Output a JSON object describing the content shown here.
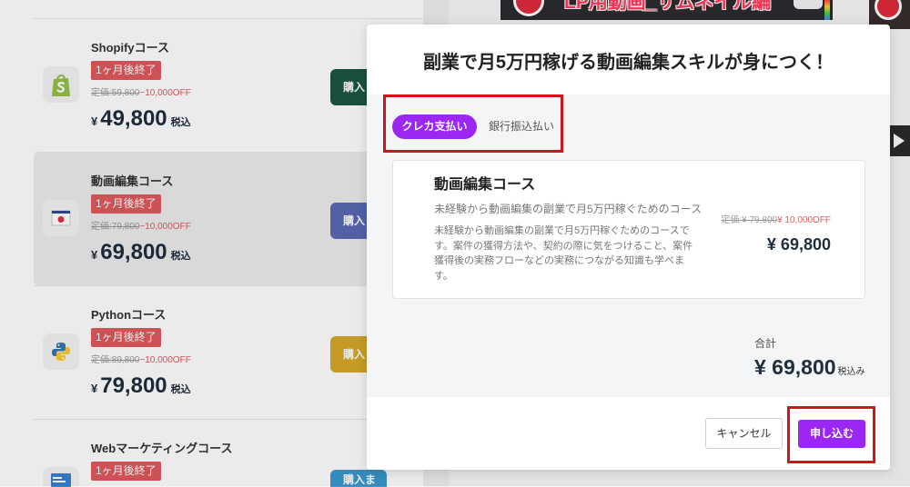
{
  "background": {
    "courses": [
      {
        "name": "Shopifyコース",
        "badge": "1ヶ月後終了",
        "list_price": "定価:59,800",
        "discount": "−10,000OFF",
        "currency": "¥",
        "price": "49,800",
        "tax": "税込",
        "button_label": "購入",
        "icon": "shopify-icon",
        "button_color": "#1d5643"
      },
      {
        "name": "動画編集コース",
        "badge": "1ヶ月後終了",
        "list_price": "定価:79,800",
        "discount": "−10,000OFF",
        "currency": "¥",
        "price": "69,800",
        "tax": "税込",
        "button_label": "購入",
        "icon": "video-icon",
        "button_color": "#5b69b5",
        "selected": true
      },
      {
        "name": "Pythonコース",
        "badge": "1ヶ月後終了",
        "list_price": "定価:89,800",
        "discount": "−10,000OFF",
        "currency": "¥",
        "price": "79,800",
        "tax": "税込",
        "button_label": "購入",
        "icon": "python-icon",
        "button_color": "#d6a92a"
      },
      {
        "name": "Webマーケティングコース",
        "badge": "1ヶ月後終了",
        "button_label": "購入ま",
        "icon": "web-marketing-icon",
        "button_color": "#3a97cc"
      }
    ],
    "video_thumbnail_title": "LP用動画_サムネイル編"
  },
  "modal": {
    "title": "副業で月5万円稼げる動画編集スキルが身につく！",
    "payment_tabs": [
      {
        "label": "クレカ支払い",
        "active": true
      },
      {
        "label": "銀行振込払い",
        "active": false
      }
    ],
    "course": {
      "name": "動画編集コース",
      "subtitle": "未経験から動画編集の副業で月5万円稼ぐためのコース",
      "description": "未経験から動画編集の副業で月5万円稼ぐためのコースです。案件の獲得方法や、契約の際に気をつけること、案件獲得後の実務フローなどの実務につながる知識も学べます。",
      "list_price": "定価:¥ 79,800",
      "discount": "¥ 10,000OFF",
      "price": "¥ 69,800"
    },
    "total": {
      "label": "合計",
      "amount": "¥ 69,800",
      "tax_note": "税込み"
    },
    "buttons": {
      "cancel": "キャンセル",
      "submit": "申し込む"
    }
  },
  "colors": {
    "accent": "#9c27f3",
    "badge": "#e05a5d",
    "discount_text": "#e05a5d",
    "price_text": "#1f2d3d",
    "annotation": "#d4141c"
  }
}
